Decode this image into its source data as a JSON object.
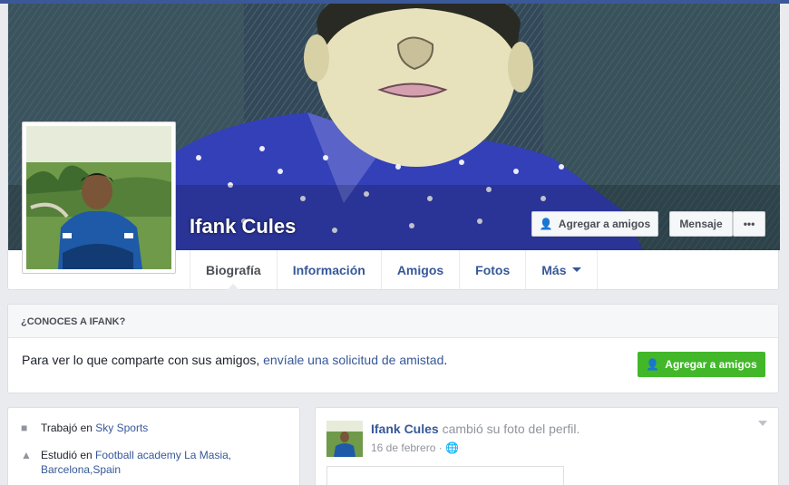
{
  "profile": {
    "name": "Ifank Cules",
    "buttons": {
      "add_friend": "Agregar a amigos",
      "message": "Mensaje",
      "more": "•••"
    }
  },
  "tabs": [
    {
      "label": "Biografía"
    },
    {
      "label": "Información"
    },
    {
      "label": "Amigos"
    },
    {
      "label": "Fotos"
    },
    {
      "label": "Más"
    }
  ],
  "know_card": {
    "heading": "¿CONOCES A IFANK?",
    "text": "Para ver lo que comparte con sus amigos, ",
    "link": "envíale una solicitud de amistad",
    "suffix": ".",
    "button": "Agregar a amigos"
  },
  "intro": {
    "work": {
      "prefix": "Trabajó en ",
      "place": "Sky Sports"
    },
    "study": {
      "prefix": "Estudió en ",
      "place_line1": "Football academy La Masia,",
      "place_line2": "Barcelona,Spain"
    }
  },
  "post": {
    "author": "Ifank Cules",
    "action": " cambió su foto del perfil.",
    "date": "16 de febrero",
    "separator": " · ",
    "privacy_icon": "globe-icon"
  },
  "icons": {
    "add_friend": "add-friend-icon",
    "work": "briefcase-icon",
    "study": "graduation-cap-icon",
    "chevron": "chevron-down-icon"
  },
  "colors": {
    "brand": "#3b5998",
    "link": "#365899",
    "green": "#42b72a"
  }
}
